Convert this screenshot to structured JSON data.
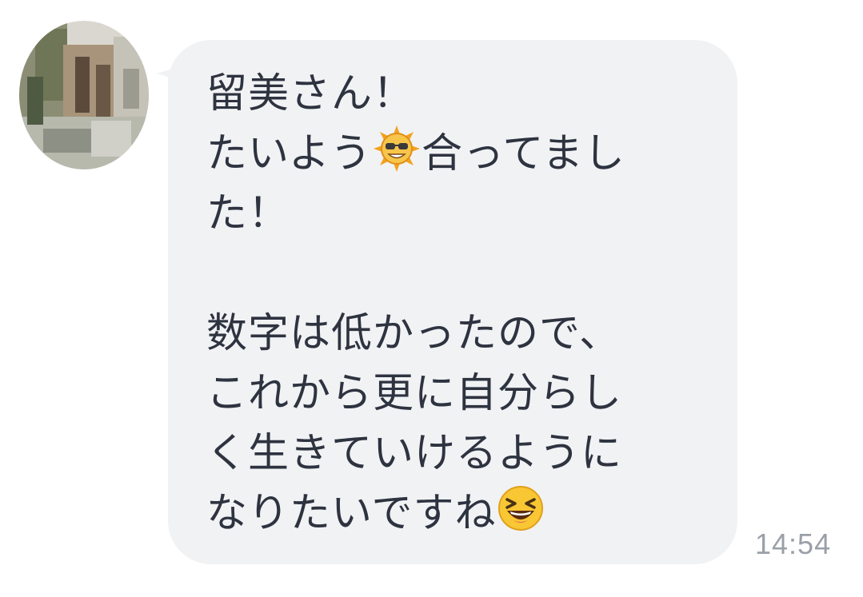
{
  "message": {
    "line1": "留美さん！",
    "line2_before_emoji": "たいよう",
    "line2_after_emoji": "合ってまし",
    "line3": "た！",
    "line4": "数字は低かったので、",
    "line5": "これから更に自分らし",
    "line6": "く生きていけるように",
    "line7_before_emoji": "なりたいですね",
    "emoji_sun": "sun-with-sunglasses",
    "emoji_laugh": "laughing-face"
  },
  "timestamp": "14:54",
  "colors": {
    "bubble": "#f1f2f4",
    "text": "#2e3340",
    "timestamp": "#9aa0a8"
  }
}
